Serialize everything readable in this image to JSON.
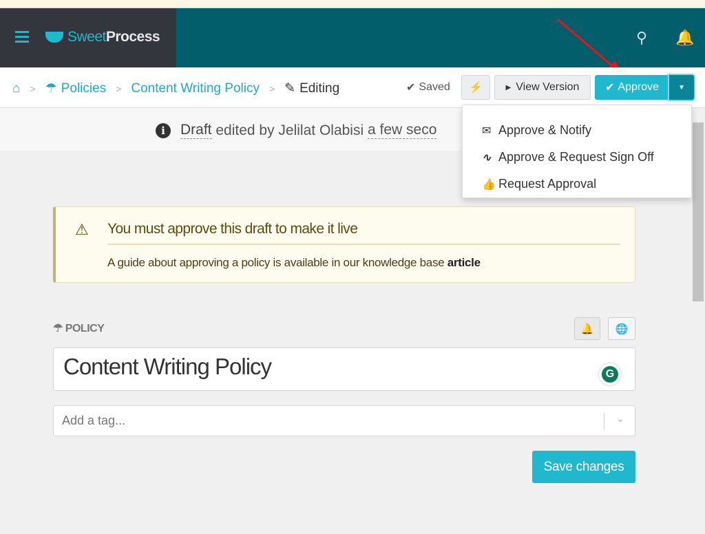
{
  "header": {
    "logo_part1": "Sweet",
    "logo_part2": "Process"
  },
  "breadcrumb": {
    "items": [
      "Policies",
      "Content Writing Policy"
    ],
    "current": "Editing"
  },
  "toolbar": {
    "saved": "Saved",
    "view_version": "View Version",
    "approve": "Approve"
  },
  "info": {
    "draft": "Draft",
    "edited_by": "edited by Jelilat Olabisi",
    "time": "a few seco"
  },
  "approve_menu": {
    "items": [
      {
        "icon": "envelope-icon",
        "label": "Approve & Notify"
      },
      {
        "icon": "signature-icon",
        "label": "Approve & Request Sign Off"
      },
      {
        "icon": "thumbs-up-icon",
        "label": "Request Approval"
      }
    ]
  },
  "alert": {
    "title": "You must approve this draft to make it live",
    "body": "A guide about approving a policy is available in our knowledge base",
    "link": "article"
  },
  "policy": {
    "label": "POLICY",
    "title": "Content Writing Policy",
    "tag_placeholder": "Add a tag...",
    "save": "Save changes"
  },
  "colors": {
    "header_teal": "#025e6b",
    "brand_dark": "#33373d",
    "accent": "#1fb8cf",
    "annotation_arrow": "#e8141a"
  }
}
